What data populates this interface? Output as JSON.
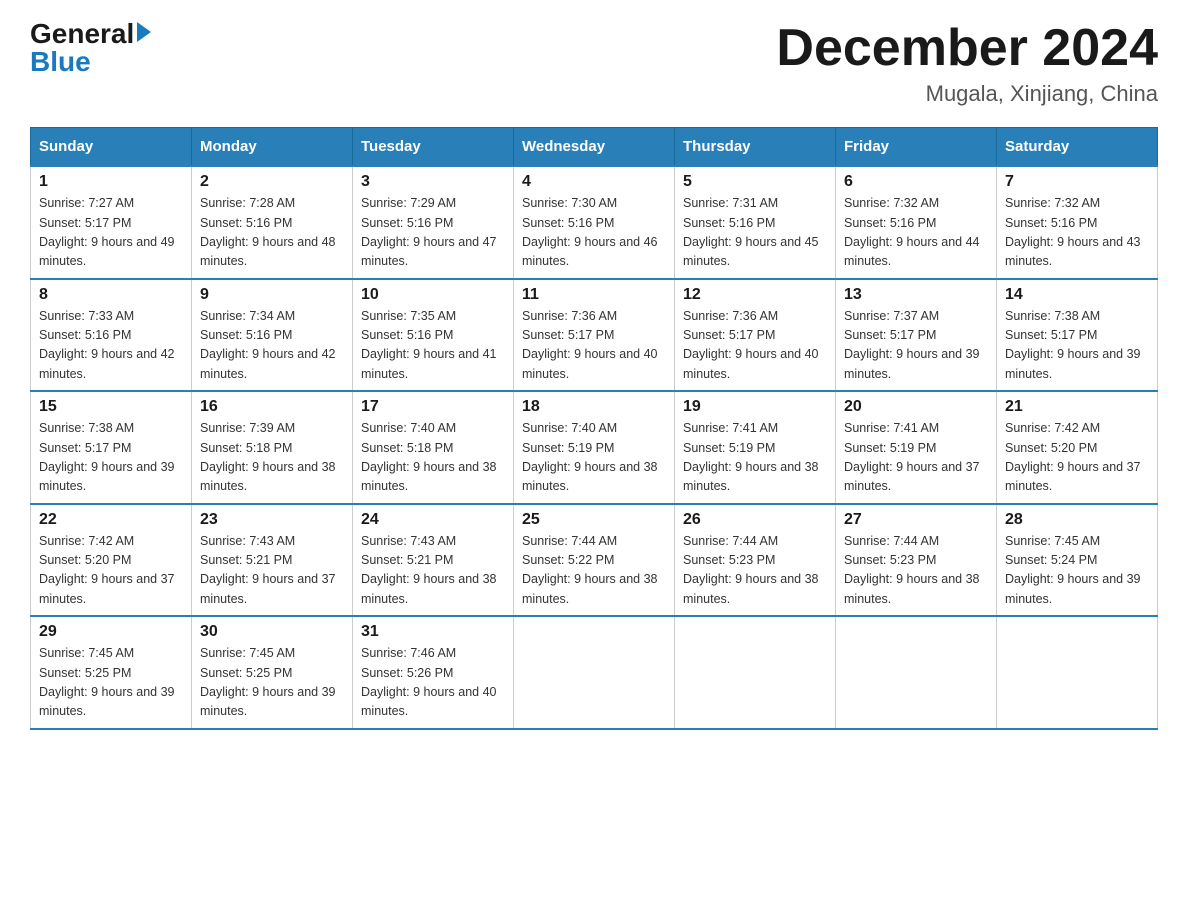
{
  "logo": {
    "general": "General",
    "blue": "Blue",
    "arrow": true
  },
  "title": "December 2024",
  "subtitle": "Mugala, Xinjiang, China",
  "headers": [
    "Sunday",
    "Monday",
    "Tuesday",
    "Wednesday",
    "Thursday",
    "Friday",
    "Saturday"
  ],
  "weeks": [
    [
      {
        "day": "1",
        "sunrise": "7:27 AM",
        "sunset": "5:17 PM",
        "daylight": "9 hours and 49 minutes."
      },
      {
        "day": "2",
        "sunrise": "7:28 AM",
        "sunset": "5:16 PM",
        "daylight": "9 hours and 48 minutes."
      },
      {
        "day": "3",
        "sunrise": "7:29 AM",
        "sunset": "5:16 PM",
        "daylight": "9 hours and 47 minutes."
      },
      {
        "day": "4",
        "sunrise": "7:30 AM",
        "sunset": "5:16 PM",
        "daylight": "9 hours and 46 minutes."
      },
      {
        "day": "5",
        "sunrise": "7:31 AM",
        "sunset": "5:16 PM",
        "daylight": "9 hours and 45 minutes."
      },
      {
        "day": "6",
        "sunrise": "7:32 AM",
        "sunset": "5:16 PM",
        "daylight": "9 hours and 44 minutes."
      },
      {
        "day": "7",
        "sunrise": "7:32 AM",
        "sunset": "5:16 PM",
        "daylight": "9 hours and 43 minutes."
      }
    ],
    [
      {
        "day": "8",
        "sunrise": "7:33 AM",
        "sunset": "5:16 PM",
        "daylight": "9 hours and 42 minutes."
      },
      {
        "day": "9",
        "sunrise": "7:34 AM",
        "sunset": "5:16 PM",
        "daylight": "9 hours and 42 minutes."
      },
      {
        "day": "10",
        "sunrise": "7:35 AM",
        "sunset": "5:16 PM",
        "daylight": "9 hours and 41 minutes."
      },
      {
        "day": "11",
        "sunrise": "7:36 AM",
        "sunset": "5:17 PM",
        "daylight": "9 hours and 40 minutes."
      },
      {
        "day": "12",
        "sunrise": "7:36 AM",
        "sunset": "5:17 PM",
        "daylight": "9 hours and 40 minutes."
      },
      {
        "day": "13",
        "sunrise": "7:37 AM",
        "sunset": "5:17 PM",
        "daylight": "9 hours and 39 minutes."
      },
      {
        "day": "14",
        "sunrise": "7:38 AM",
        "sunset": "5:17 PM",
        "daylight": "9 hours and 39 minutes."
      }
    ],
    [
      {
        "day": "15",
        "sunrise": "7:38 AM",
        "sunset": "5:17 PM",
        "daylight": "9 hours and 39 minutes."
      },
      {
        "day": "16",
        "sunrise": "7:39 AM",
        "sunset": "5:18 PM",
        "daylight": "9 hours and 38 minutes."
      },
      {
        "day": "17",
        "sunrise": "7:40 AM",
        "sunset": "5:18 PM",
        "daylight": "9 hours and 38 minutes."
      },
      {
        "day": "18",
        "sunrise": "7:40 AM",
        "sunset": "5:19 PM",
        "daylight": "9 hours and 38 minutes."
      },
      {
        "day": "19",
        "sunrise": "7:41 AM",
        "sunset": "5:19 PM",
        "daylight": "9 hours and 38 minutes."
      },
      {
        "day": "20",
        "sunrise": "7:41 AM",
        "sunset": "5:19 PM",
        "daylight": "9 hours and 37 minutes."
      },
      {
        "day": "21",
        "sunrise": "7:42 AM",
        "sunset": "5:20 PM",
        "daylight": "9 hours and 37 minutes."
      }
    ],
    [
      {
        "day": "22",
        "sunrise": "7:42 AM",
        "sunset": "5:20 PM",
        "daylight": "9 hours and 37 minutes."
      },
      {
        "day": "23",
        "sunrise": "7:43 AM",
        "sunset": "5:21 PM",
        "daylight": "9 hours and 37 minutes."
      },
      {
        "day": "24",
        "sunrise": "7:43 AM",
        "sunset": "5:21 PM",
        "daylight": "9 hours and 38 minutes."
      },
      {
        "day": "25",
        "sunrise": "7:44 AM",
        "sunset": "5:22 PM",
        "daylight": "9 hours and 38 minutes."
      },
      {
        "day": "26",
        "sunrise": "7:44 AM",
        "sunset": "5:23 PM",
        "daylight": "9 hours and 38 minutes."
      },
      {
        "day": "27",
        "sunrise": "7:44 AM",
        "sunset": "5:23 PM",
        "daylight": "9 hours and 38 minutes."
      },
      {
        "day": "28",
        "sunrise": "7:45 AM",
        "sunset": "5:24 PM",
        "daylight": "9 hours and 39 minutes."
      }
    ],
    [
      {
        "day": "29",
        "sunrise": "7:45 AM",
        "sunset": "5:25 PM",
        "daylight": "9 hours and 39 minutes."
      },
      {
        "day": "30",
        "sunrise": "7:45 AM",
        "sunset": "5:25 PM",
        "daylight": "9 hours and 39 minutes."
      },
      {
        "day": "31",
        "sunrise": "7:46 AM",
        "sunset": "5:26 PM",
        "daylight": "9 hours and 40 minutes."
      },
      null,
      null,
      null,
      null
    ]
  ]
}
